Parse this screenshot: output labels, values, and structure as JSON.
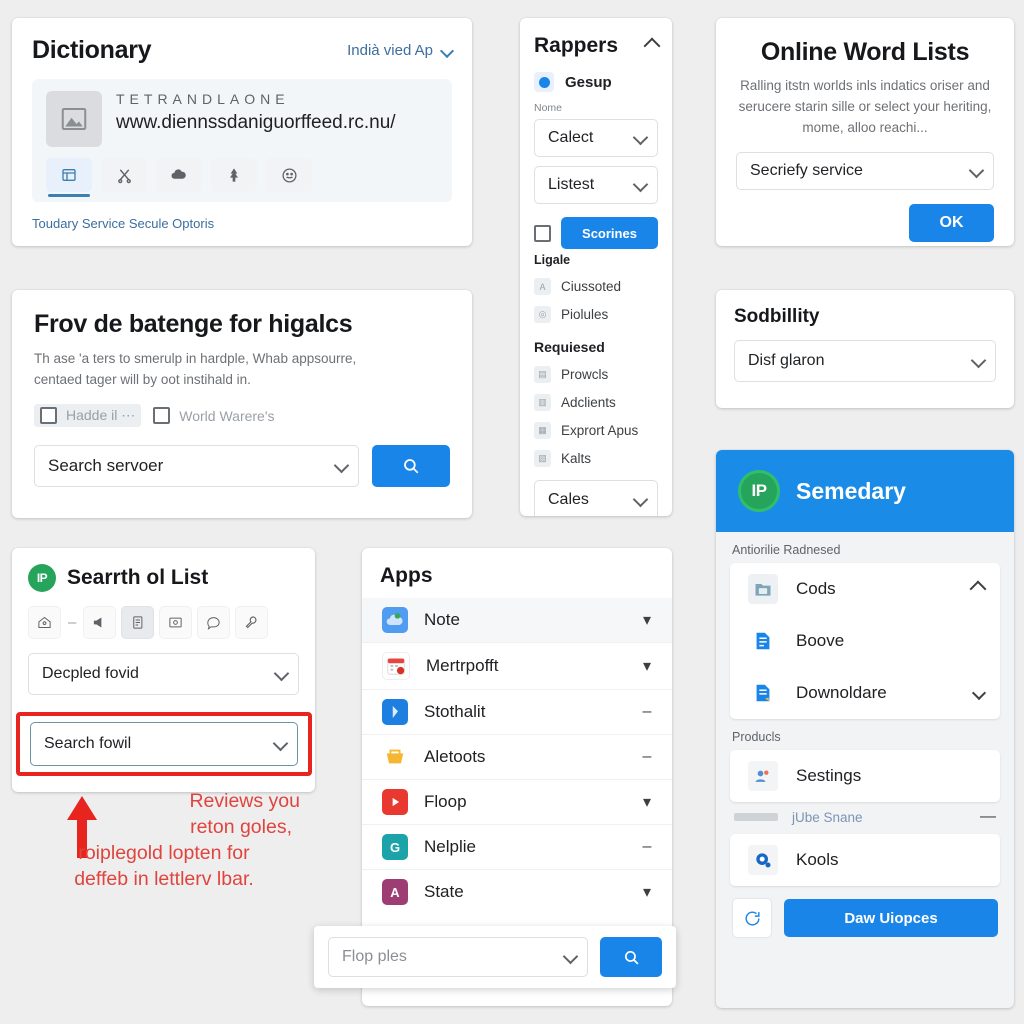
{
  "dictionary": {
    "title": "Dictionary",
    "header_link": "Indià vied Ap",
    "site_name": "TETRANDLAONE",
    "site_url": "www.diennssdaniguorffeed.rc.nu/",
    "tabs": [
      {
        "name": "browser-icon",
        "glyph": "▣"
      },
      {
        "name": "scissors-icon",
        "glyph": "✂"
      },
      {
        "name": "cloud-icon",
        "glyph": "☁"
      },
      {
        "name": "tree-icon",
        "glyph": "♣"
      },
      {
        "name": "emoji-icon",
        "glyph": "☺"
      }
    ],
    "footer_link": "Toudary Service Secule Optoris"
  },
  "search_panel": {
    "title": "Frov de batenge for higalcs",
    "body_line1": "Th ase 'a ters to smerulp in hardple, Whab appsourre,",
    "body_line2": "centaed tager will by oot instihald in.",
    "checkboxes": [
      {
        "label": "Hadde il ⋯",
        "shaded": true
      },
      {
        "label": "World Warere's",
        "shaded": false
      }
    ],
    "select_value": "Search servoer",
    "search_icon": "magnifier-icon"
  },
  "list_panel": {
    "badge": "IP",
    "title": "Searrth ol List",
    "tools": [
      {
        "name": "home-icon",
        "glyph": "⌂",
        "active": false
      },
      {
        "name": "dash-separator",
        "glyph": "–",
        "active": false
      },
      {
        "name": "megaphone-icon",
        "glyph": "📢",
        "active": false
      },
      {
        "name": "document-icon",
        "glyph": "📄",
        "active": true
      },
      {
        "name": "image-icon",
        "glyph": "🖼",
        "active": false
      },
      {
        "name": "comment-icon",
        "glyph": "💬",
        "active": false
      },
      {
        "name": "wrench-icon",
        "glyph": "🔧",
        "active": false
      }
    ],
    "select_top": "Decpled fovid",
    "select_focused": "Search fowil",
    "annotation_line1": "Reviews you",
    "annotation_line2": "reton goles,",
    "annotation_line3": "roiplegold lopten for",
    "annotation_line4": "deffeb in lettlerv lbar.",
    "highlight_color": "#e8241f",
    "annotation_color": "#e0443e"
  },
  "rappers": {
    "title": "Rappers",
    "collapse_icon": "chevron-up-icon",
    "radio_label": "Gesup",
    "field_label": "Nome",
    "select_1": "Calect",
    "select_2": "Listest",
    "button": "Scorines",
    "checkbox_label": "Ligale",
    "nav_items": [
      {
        "label": "Ciussoted",
        "glyph": "A"
      },
      {
        "label": "Piolules",
        "glyph": "◎"
      }
    ],
    "section_label": "Requiesed",
    "nav_items_2": [
      {
        "label": "Prowcls",
        "glyph": "▤"
      },
      {
        "label": "Adclients",
        "glyph": "▥"
      },
      {
        "label": "Exprort Apus",
        "glyph": "▦"
      },
      {
        "label": "Kalts",
        "glyph": "▧"
      }
    ],
    "select_bottom": "Cales"
  },
  "apps": {
    "title": "Apps",
    "rows": [
      {
        "label": "Note",
        "control": "chevron-down",
        "color": "#4f9cf0",
        "glyph": "☁",
        "highlight": true
      },
      {
        "label": "Mertrpofft",
        "control": "chevron-down",
        "color": "#f4f4f4",
        "glyph": "☷",
        "highlight": false
      },
      {
        "label": "Stothalit",
        "control": "dash",
        "color": "#1d7fe0",
        "glyph": "⚑",
        "highlight": false
      },
      {
        "label": "Aletoots",
        "control": "dash",
        "color": "#f5b731",
        "glyph": "☗",
        "highlight": false
      },
      {
        "label": "Floop",
        "control": "chevron-down",
        "color": "#e8382f",
        "glyph": "▶",
        "highlight": false
      },
      {
        "label": "Nelplie",
        "control": "dash",
        "color": "#1aa3a8",
        "glyph": "G",
        "highlight": false
      },
      {
        "label": "State",
        "control": "chevron-down",
        "color": "#9e3c74",
        "glyph": "A",
        "highlight": false
      }
    ],
    "footer_select": "Flop ples",
    "footer_search_icon": "magnifier-icon"
  },
  "word_lists": {
    "title": "Online Word Lists",
    "body_line1": "Ralling itstn worlds inls indatics oriser and",
    "body_line2": "serucere starin sille or select your heriting,",
    "body_line3": "mome, alloo reachi...",
    "select_value": "Secriefy service",
    "ok_button": "OK"
  },
  "sodbillity": {
    "title": "Sodbillity",
    "select_value": "Disf glaron"
  },
  "semedary": {
    "logo": "IP",
    "title": "Semedary",
    "subtitle": "Antiorilie Radnesed",
    "rows": [
      {
        "label": "Cods",
        "control": "chevron-up",
        "color": "#60a3bf",
        "glyph": "▣"
      },
      {
        "label": "Boove",
        "control": "",
        "color": "#1a85e8",
        "glyph": "☰"
      },
      {
        "label": "Downoldare",
        "control": "chevron-down",
        "color": "#1a85e8",
        "glyph": "☰"
      }
    ],
    "products_label": "Producls",
    "product_rows": [
      {
        "label": "Sestings",
        "color": "#4f8fd8",
        "glyph": "☸"
      }
    ],
    "ghost_link": "jUbe Snane",
    "ghost_control": "dash",
    "kools_rows": [
      {
        "label": "Kools",
        "color": "#1667c4",
        "glyph": "◉"
      }
    ],
    "fab_icon": "refresh-icon",
    "cta_button": "Daw Uiopces"
  },
  "colors": {
    "accent_blue": "#1a85e8",
    "header_blue": "#1a8ce8",
    "green": "#27a45c",
    "red": "#e8241f",
    "page_bg": "#eeeeee"
  }
}
